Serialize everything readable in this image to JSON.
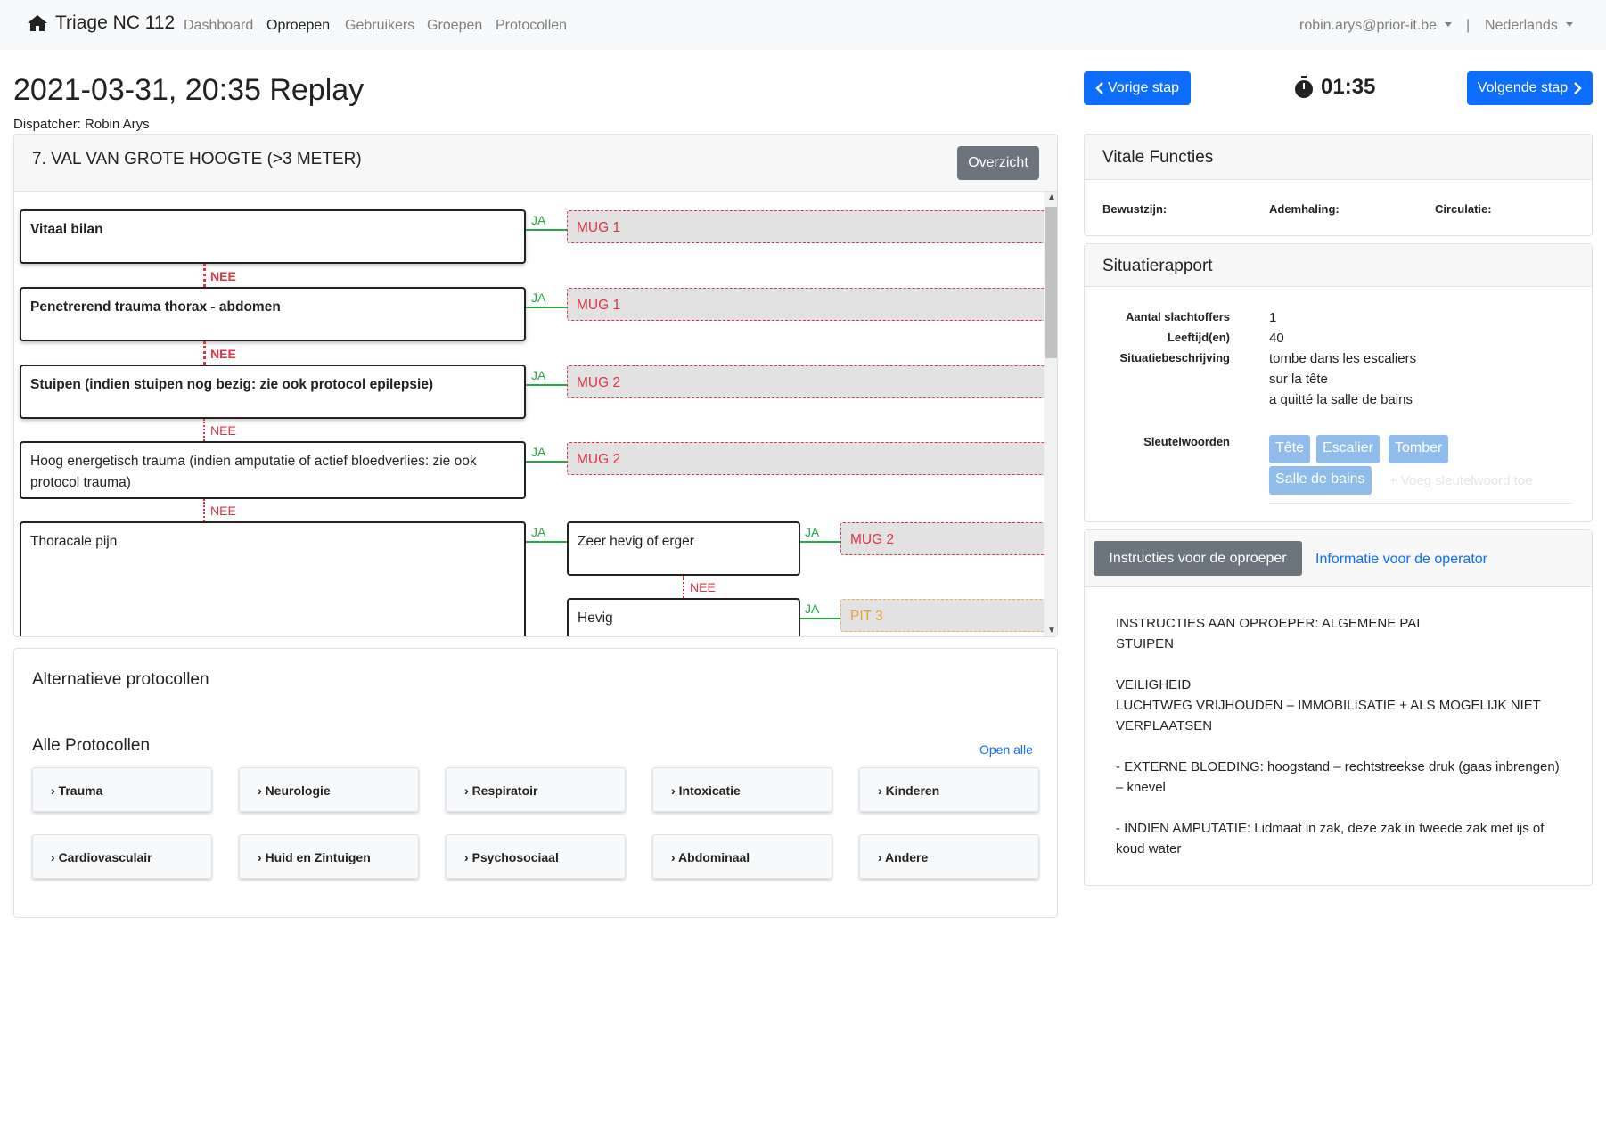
{
  "navbar": {
    "brand": "Triage NC 112",
    "links": [
      "Dashboard",
      "Oproepen",
      "Gebruikers",
      "Groepen",
      "Protocollen"
    ],
    "active_link": "Oproepen",
    "user": "robin.arys@prior-it.be",
    "separator": "|",
    "language": "Nederlands"
  },
  "header": {
    "title": "2021-03-31, 20:35 Replay",
    "dispatcher": "Dispatcher: Robin Arys",
    "prev_button": "Vorige stap",
    "next_button": "Volgende stap",
    "timer": "01:35"
  },
  "flowchart": {
    "title": "7. VAL VAN GROTE HOOGTE (>3 METER)",
    "overview_button": "Overzicht",
    "yes_label": "JA",
    "no_label": "NEE",
    "questions": [
      "Vitaal bilan",
      "Penetrerend trauma thorax - abdomen",
      "Stuipen (indien stuipen nog bezig: zie ook protocol epilepsie)",
      "Hoog energetisch trauma (indien amputatie of actief bloedverlies: zie ook protocol trauma)",
      "Thoracale pijn",
      "Zeer hevig of erger",
      "Hevig"
    ],
    "results": [
      "MUG 1",
      "MUG 1",
      "MUG 2",
      "MUG 2",
      "MUG 2",
      "PIT 3"
    ]
  },
  "alternatives": {
    "title": "Alternatieve protocollen",
    "all_title": "Alle Protocollen",
    "open_all": "Open alle",
    "protocols": [
      "Trauma",
      "Neurologie",
      "Respiratoir",
      "Intoxicatie",
      "Kinderen",
      "Cardiovasculair",
      "Huid en Zintuigen",
      "Psychosociaal",
      "Abdominaal",
      "Andere"
    ]
  },
  "vitals": {
    "title": "Vitale Functies",
    "labels": [
      "Bewustzijn:",
      "Ademhaling:",
      "Circulatie:"
    ]
  },
  "situation": {
    "title": "Situatierapport",
    "victims_label": "Aantal slachtoffers",
    "victims_value": "1",
    "age_label": "Leeftijd(en)",
    "age_value": "40",
    "description_label": "Situatiebeschrijving",
    "description_lines": [
      "tombe dans les escaliers",
      "sur la tête",
      "a quitté la salle de bains"
    ],
    "keywords_label": "Sleutelwoorden",
    "keywords": [
      "Tête",
      "Escalier",
      "Tomber",
      "Salle de bains"
    ],
    "add_keyword_placeholder": "+ Voeg sleutelwoord toe"
  },
  "instructions": {
    "tab_caller": "Instructies voor de oproeper",
    "tab_operator": "Informatie voor de operator",
    "text": "INSTRUCTIES AAN OPROEPER: ALGEMENE PAI\nSTUIPEN\n\nVEILIGHEID\nLUCHTWEG VRIJHOUDEN – IMMOBILISATIE + ALS MOGELIJK NIET VERPLAATSEN\n\n- EXTERNE BLOEDING: hoogstand – rechtstreekse druk (gaas inbrengen) – knevel\n\n- INDIEN AMPUTATIE: Lidmaat in zak, deze zak in tweede zak met ijs of koud water"
  }
}
